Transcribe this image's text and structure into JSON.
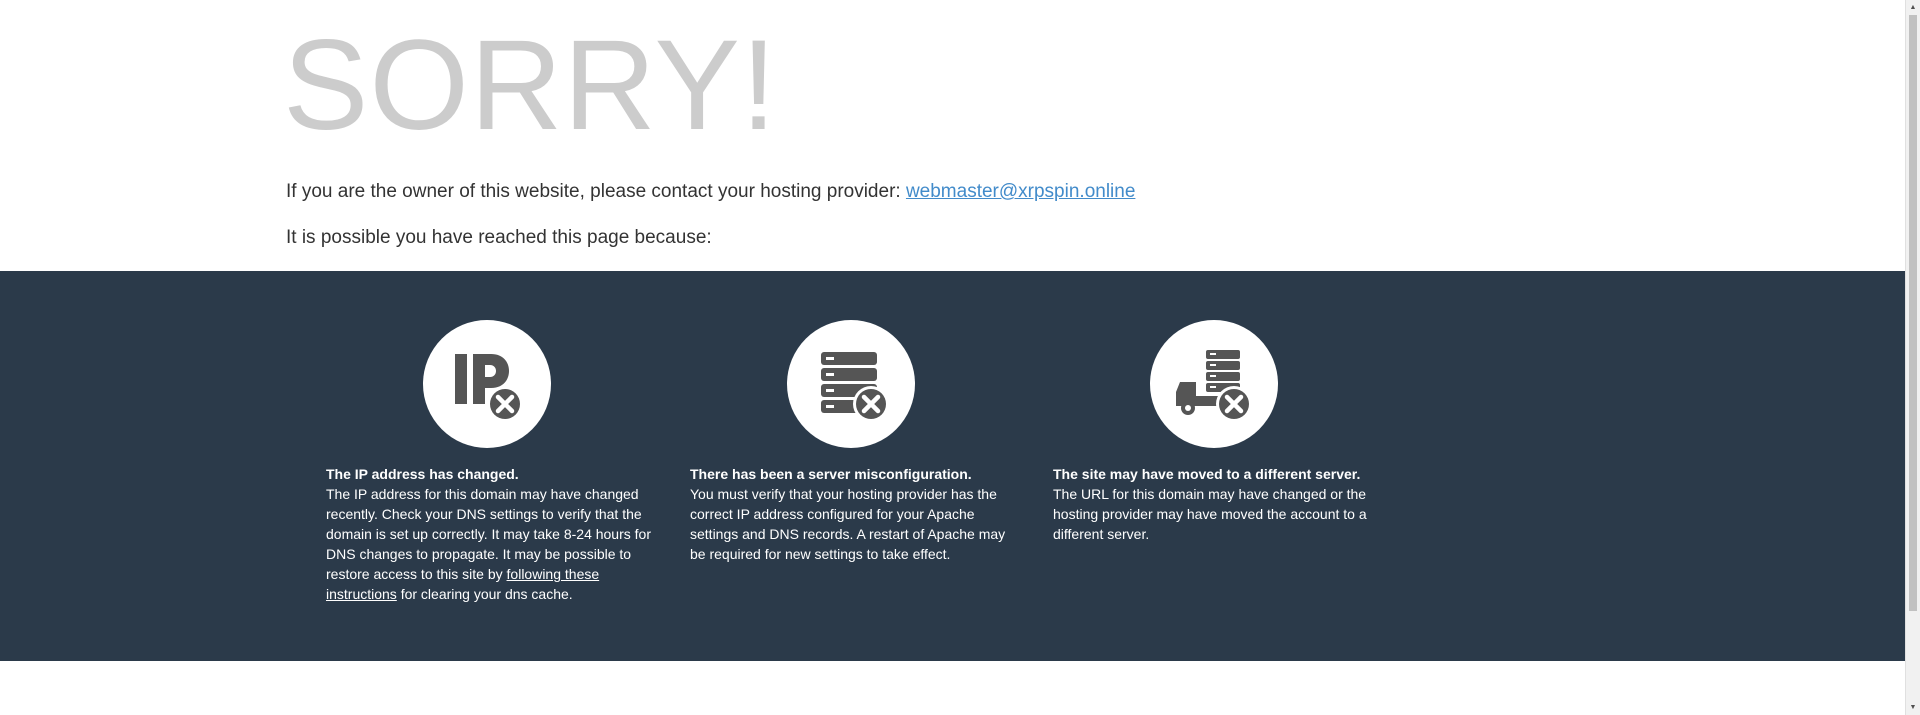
{
  "heading": "SORRY!",
  "owner_text": "If you are the owner of this website, please contact your hosting provider: ",
  "contact_email": "webmaster@xrpspin.online",
  "reason_intro": "It is possible you have reached this page because:",
  "reasons": [
    {
      "title": "The IP address has changed.",
      "body": "The IP address for this domain may have changed recently. Check your DNS settings to verify that the domain is set up correctly. It may take 8-24 hours for DNS changes to propagate. It may be possible to restore access to this site by ",
      "link": "following these instructions",
      "body_after": " for clearing your dns cache.",
      "icon": "ip-error-icon"
    },
    {
      "title": "There has been a server misconfiguration.",
      "body": "You must verify that your hosting provider has the correct IP address configured for your Apache settings and DNS records. A restart of Apache may be required for new settings to take effect.",
      "icon": "server-error-icon"
    },
    {
      "title": "The site may have moved to a different server.",
      "body": "The URL for this domain may have changed or the hosting provider may have moved the account to a different server.",
      "icon": "server-moved-icon"
    }
  ],
  "colors": {
    "band": "#2b3a4a",
    "heading": "#cccccc",
    "link": "#428bca",
    "icon": "#555555"
  }
}
